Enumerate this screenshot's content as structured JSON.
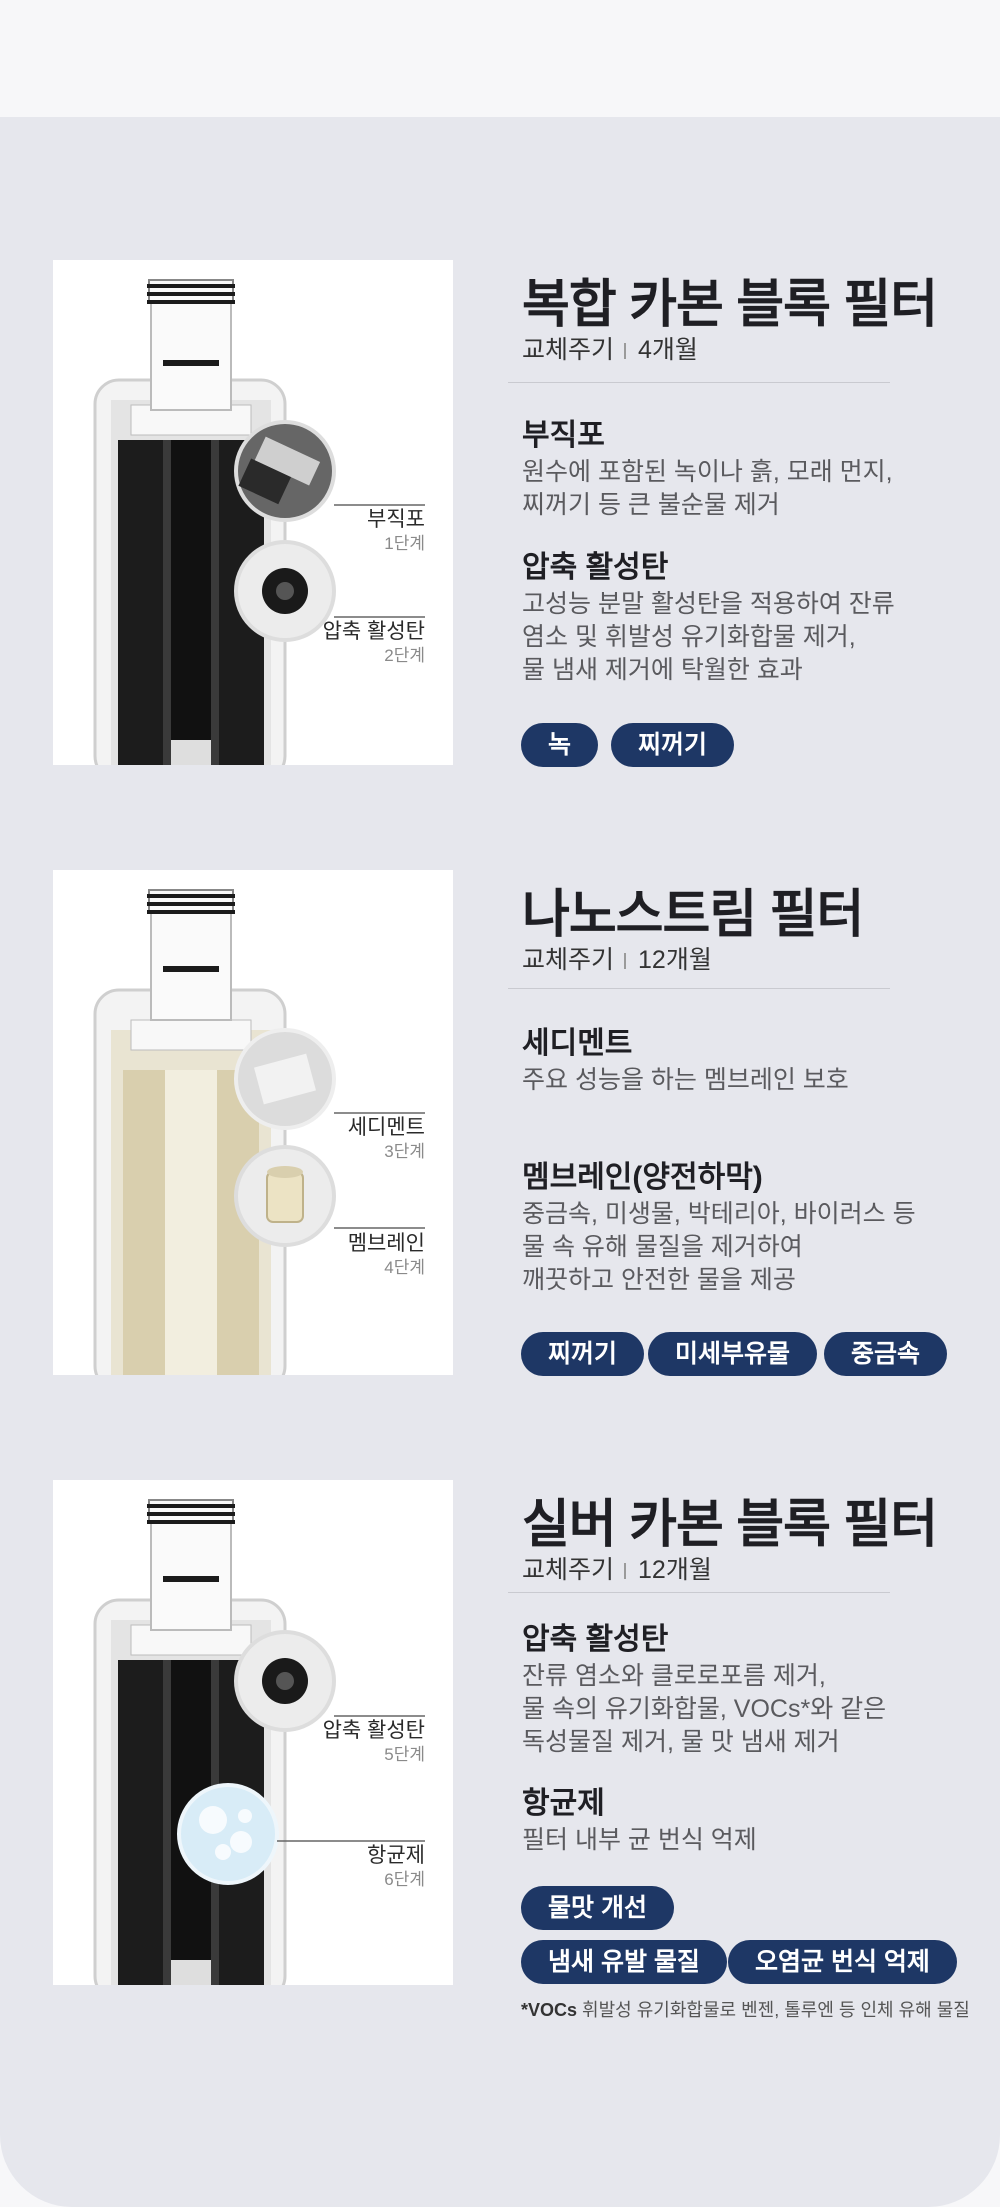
{
  "filters": [
    {
      "title": "복합 카본 블록 필터",
      "cycle_label": "교체주기",
      "cycle_value": "4개월",
      "features": [
        {
          "title": "부직포",
          "desc": "원수에 포함된 녹이나 흙, 모래 먼지,\n찌꺼기 등 큰 불순물 제거"
        },
        {
          "title": "압축 활성탄",
          "desc": "고성능 분말 활성탄을 적용하여 잔류\n염소 및 휘발성 유기화합물 제거,\n물 냄새 제거에 탁월한 효과"
        }
      ],
      "chips": [
        "녹",
        "찌꺼기"
      ],
      "stages": [
        {
          "name": "부직포",
          "step": "1단계"
        },
        {
          "name": "압축 활성탄",
          "step": "2단계"
        }
      ]
    },
    {
      "title": "나노스트림 필터",
      "cycle_label": "교체주기",
      "cycle_value": "12개월",
      "features": [
        {
          "title": "세디멘트",
          "desc": "주요 성능을 하는 멤브레인 보호"
        },
        {
          "title": "멤브레인(양전하막)",
          "desc": "중금속, 미생물, 박테리아, 바이러스 등\n물 속 유해 물질을 제거하여\n깨끗하고 안전한 물을 제공"
        }
      ],
      "chips": [
        "찌꺼기",
        "미세부유물",
        "중금속"
      ],
      "stages": [
        {
          "name": "세디멘트",
          "step": "3단계"
        },
        {
          "name": "멤브레인",
          "step": "4단계"
        }
      ]
    },
    {
      "title": "실버 카본 블록 필터",
      "cycle_label": "교체주기",
      "cycle_value": "12개월",
      "features": [
        {
          "title": "압축 활성탄",
          "desc": "잔류 염소와 클로로포름 제거,\n물 속의 유기화합물, VOCs*와 같은\n독성물질 제거, 물 맛 냄새 제거"
        },
        {
          "title": "항균제",
          "desc": "필터 내부 균 번식 억제"
        }
      ],
      "chips": [
        "물맛 개선",
        "냄새 유발 물질",
        "오염균 번식 억제"
      ],
      "stages": [
        {
          "name": "압축 활성탄",
          "step": "5단계"
        },
        {
          "name": "항균제",
          "step": "6단계"
        }
      ]
    }
  ],
  "footnote": {
    "term": "*VOCs",
    "text": "휘발성 유기화합물로 벤젠, 톨루엔 등 인체 유해 물질"
  },
  "colors": {
    "chip_bg": "#1e3765",
    "panel_bg": "#e6e7ed",
    "top_bg": "#f7f7f9"
  }
}
